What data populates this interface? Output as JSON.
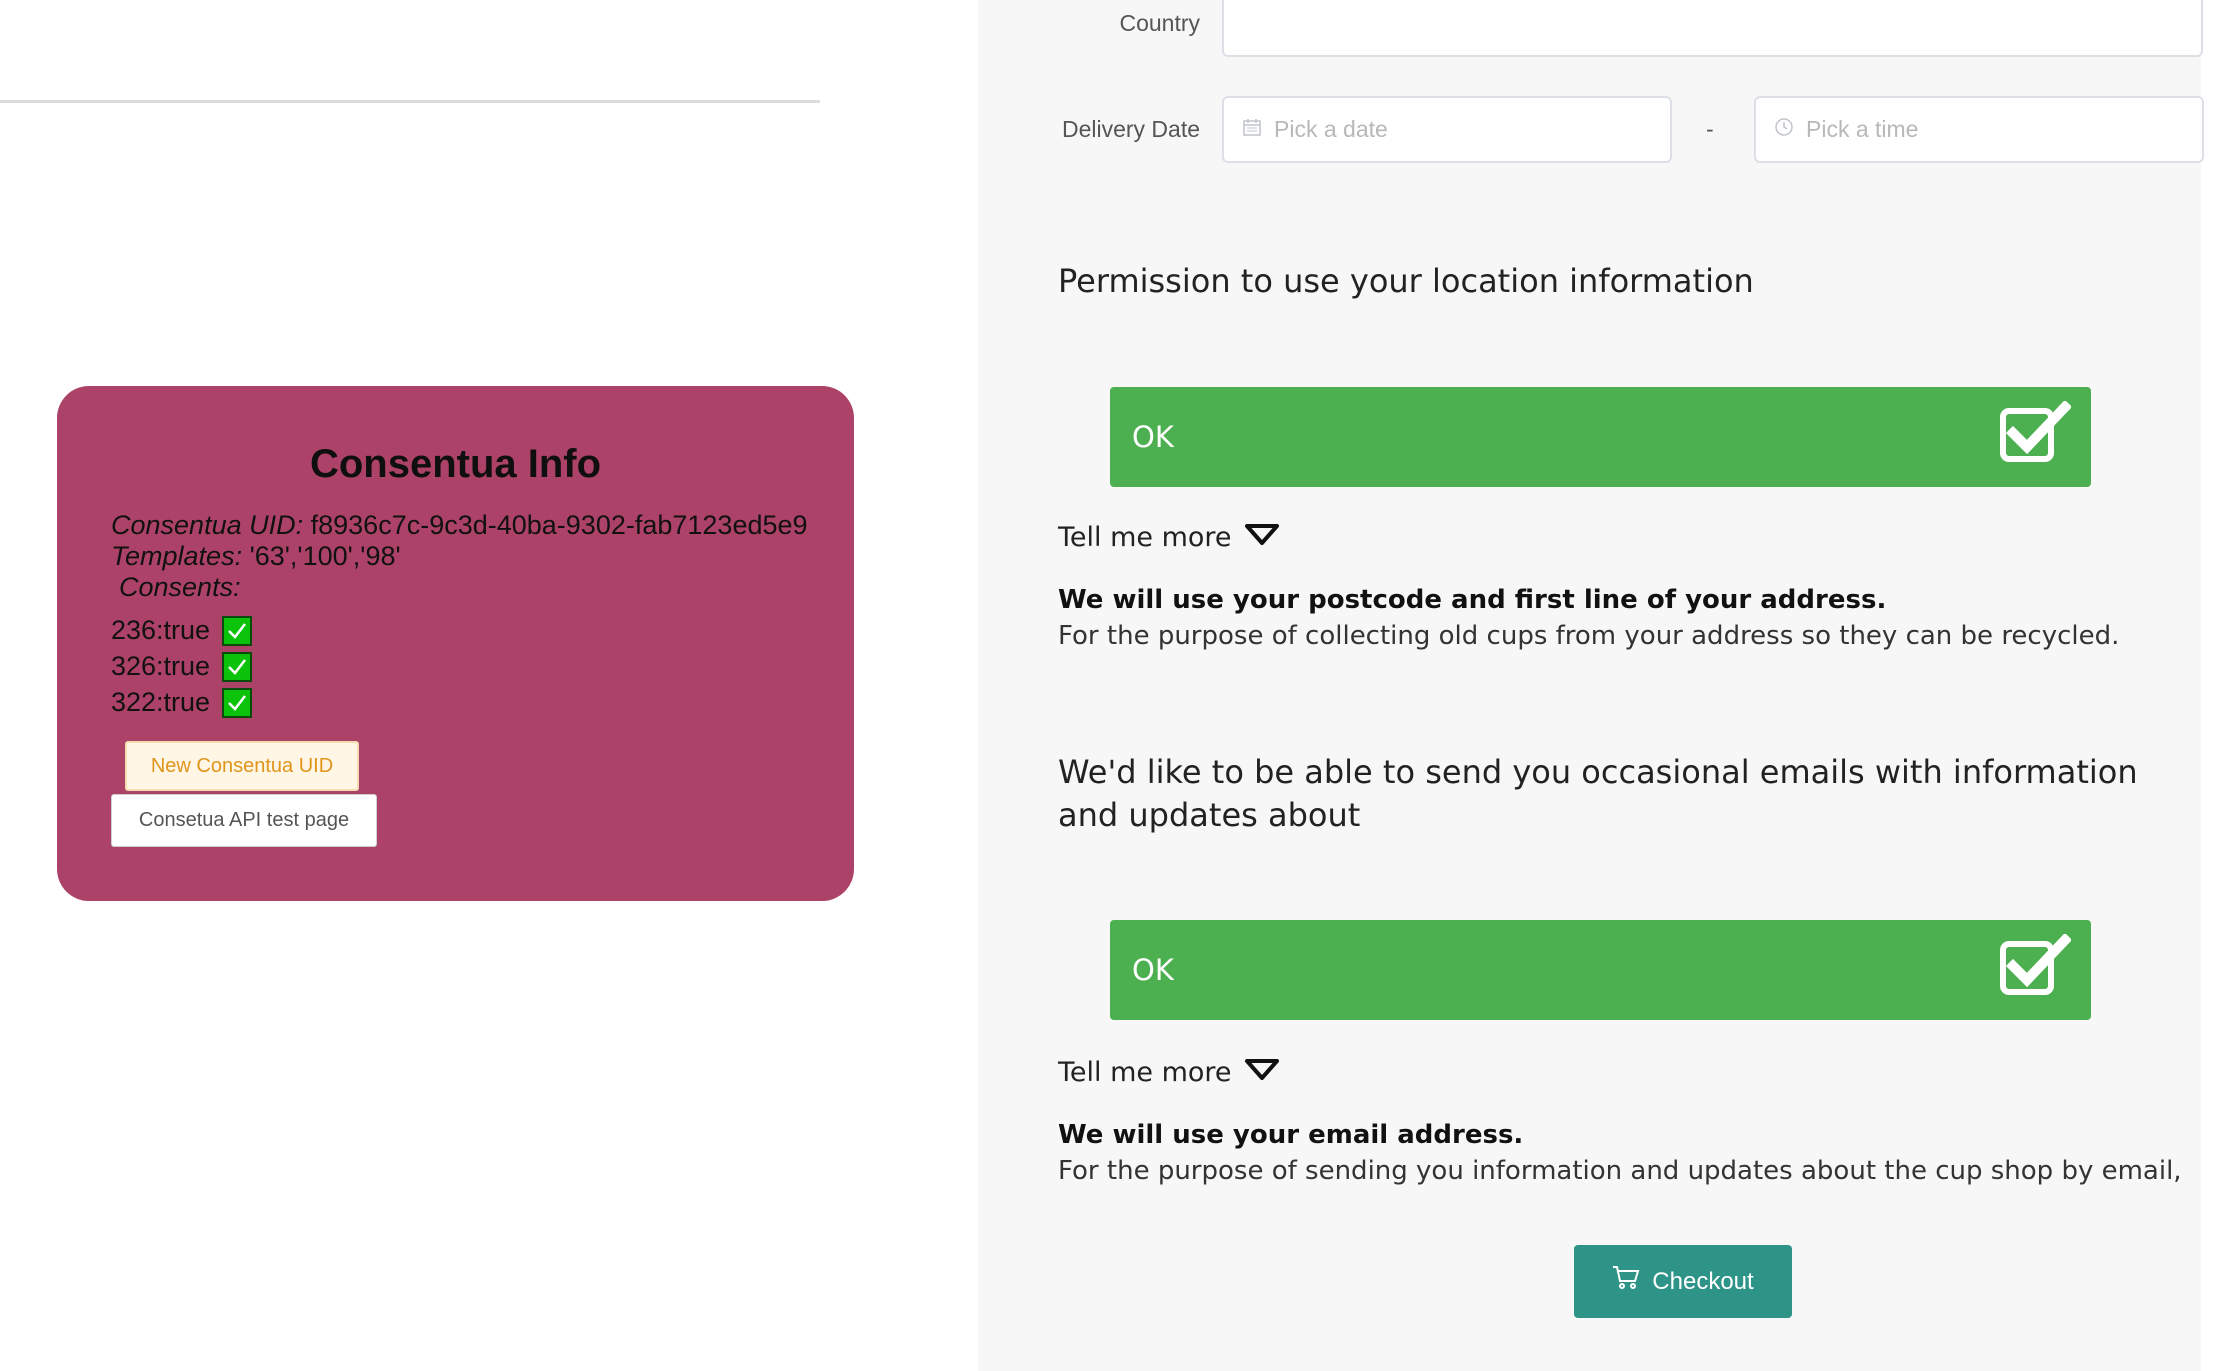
{
  "consentua": {
    "title": "Consentua Info",
    "uid_label": "Consentua UID:",
    "uid_value": "f8936c7c-9c3d-40ba-9302-fab7123ed5e9",
    "templates_label": "Templates:",
    "templates_value": "'63','100','98'",
    "consents_label": "Consents:",
    "consents": [
      "236:true",
      "326:true",
      "322:true"
    ],
    "new_uid_button": "New Consentua UID",
    "api_test_button": "Consetua API test page",
    "panel_color": "#ad4268"
  },
  "form": {
    "country_label": "Country",
    "country_value": "",
    "delivery_label": "Delivery Date",
    "date_placeholder": "Pick a date",
    "time_placeholder": "Pick a time",
    "separator": "-"
  },
  "permissions": [
    {
      "heading": "Permission to use your location information",
      "ok_label": "OK",
      "tell_more": "Tell me more",
      "purpose_bold": "We will use your postcode and first line of your address.",
      "purpose_text": "For the purpose of collecting old cups from your address so they can be recycled."
    },
    {
      "heading_line1": "We'd like to be able to send you occasional emails with information",
      "heading_line2": "and updates about",
      "ok_label": "OK",
      "tell_more": "Tell me more",
      "purpose_bold": "We will use your email address.",
      "purpose_text": "For the purpose of sending you information and updates about the cup shop by email,"
    }
  ],
  "checkout": {
    "label": "Checkout",
    "icon": "cart-icon",
    "color": "#2e9488"
  },
  "colors": {
    "ok_green": "#4caf50",
    "check_green": "#0bc30b"
  }
}
